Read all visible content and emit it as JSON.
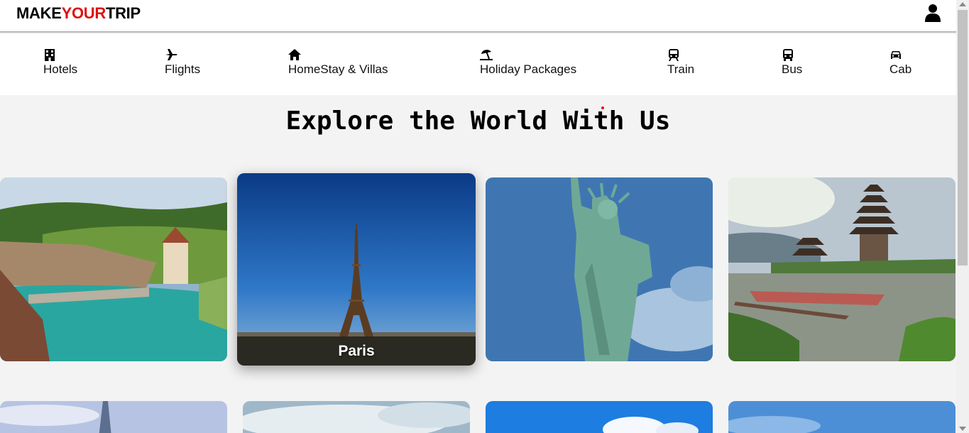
{
  "header": {
    "logo_part1": "MAKE",
    "logo_part2": "YOUR",
    "logo_part3": "TRIP",
    "user_icon": "user-icon"
  },
  "nav": {
    "items": [
      {
        "label": "Hotels",
        "icon": "hotel-icon"
      },
      {
        "label": "Flights",
        "icon": "plane-icon"
      },
      {
        "label": "HomeStay & Villas",
        "icon": "home-icon"
      },
      {
        "label": "Holiday Packages",
        "icon": "umbrella-beach-icon"
      },
      {
        "label": "Train",
        "icon": "train-icon"
      },
      {
        "label": "Bus",
        "icon": "bus-icon"
      },
      {
        "label": "Cab",
        "icon": "car-icon"
      }
    ]
  },
  "main": {
    "heading": "Explore the World With Us",
    "cards": [
      {
        "label": "",
        "image": "swiss-river-town"
      },
      {
        "label": "Paris",
        "image": "eiffel-tower"
      },
      {
        "label": "",
        "image": "statue-of-liberty"
      },
      {
        "label": "",
        "image": "bali-temple-lake"
      }
    ]
  },
  "colors": {
    "accent": "#e01010",
    "nav_bg": "#ffffff",
    "page_bg": "#f3f3f3"
  }
}
